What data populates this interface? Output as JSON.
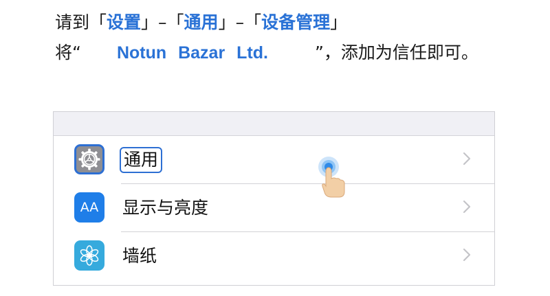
{
  "instruction": {
    "line1": {
      "prefix": "请到「",
      "settings": "设置",
      "sep1": "」–「",
      "general": "通用",
      "sep2": "」–「",
      "device_management": "设备管理",
      "suffix": "」"
    },
    "line2": {
      "prefix": "将“",
      "developer": "Notun Bazar Ltd.",
      "suffix": "”，添加为信任即可。"
    }
  },
  "settings_list": {
    "items": [
      {
        "label": "通用",
        "icon": "gear-icon",
        "highlighted": true
      },
      {
        "label": "显示与亮度",
        "icon": "display-brightness-icon",
        "icon_text": "AA"
      },
      {
        "label": "墙纸",
        "icon": "wallpaper-flower-icon"
      }
    ]
  },
  "colors": {
    "accent_blue": "#2a72d6",
    "general_icon": "#8e8e93",
    "display_icon": "#1f7ee8",
    "wallpaper_icon": "#36aadd"
  }
}
